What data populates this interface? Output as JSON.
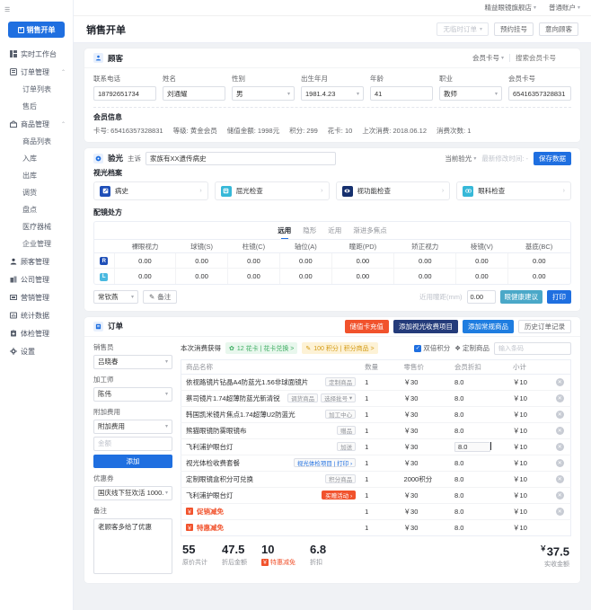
{
  "topbar": {
    "store": "精益眼镜旗舰店",
    "account": "普通账户"
  },
  "sidebar": {
    "collapse_icon": "☰",
    "primary_button": "销售开单",
    "items": [
      {
        "label": "实时工作台",
        "icon": "dashboard-icon",
        "type": "item"
      },
      {
        "label": "订单管理",
        "icon": "order-icon",
        "type": "group"
      },
      {
        "label": "订单列表",
        "type": "sub"
      },
      {
        "label": "售后",
        "type": "sub"
      },
      {
        "label": "商品管理",
        "icon": "goods-icon",
        "type": "group"
      },
      {
        "label": "商品列表",
        "type": "sub"
      },
      {
        "label": "入库",
        "type": "sub"
      },
      {
        "label": "出库",
        "type": "sub"
      },
      {
        "label": "调货",
        "type": "sub"
      },
      {
        "label": "盘点",
        "type": "sub"
      },
      {
        "label": "医疗器械",
        "type": "sub"
      },
      {
        "label": "企业管理",
        "type": "sub"
      },
      {
        "label": "顾客管理",
        "icon": "user-icon",
        "type": "item"
      },
      {
        "label": "公司管理",
        "icon": "company-icon",
        "type": "item"
      },
      {
        "label": "营销管理",
        "icon": "marketing-icon",
        "type": "item"
      },
      {
        "label": "统计数据",
        "icon": "chart-icon",
        "type": "item"
      },
      {
        "label": "体检管理",
        "icon": "clipboard-icon",
        "type": "item"
      },
      {
        "label": "设置",
        "icon": "gear-icon",
        "type": "item"
      }
    ]
  },
  "page": {
    "title": "销售开单",
    "actions": {
      "temp_order": "无临时订单",
      "appointment": "预约挂号",
      "intent_customer": "意向顾客"
    }
  },
  "customer": {
    "title": "顾客",
    "search_select": "会员卡号",
    "search_placeholder": "搜索会员卡号",
    "fields": [
      {
        "label": "联系电话",
        "value": "18792651734",
        "type": "input"
      },
      {
        "label": "姓名",
        "value": "刘通耀",
        "type": "input"
      },
      {
        "label": "性别",
        "value": "男",
        "type": "select"
      },
      {
        "label": "出生年月",
        "value": "1981.4.23",
        "type": "select"
      },
      {
        "label": "年龄",
        "value": "41",
        "type": "input"
      },
      {
        "label": "职业",
        "value": "教师",
        "type": "select"
      },
      {
        "label": "会员卡号",
        "value": "65416357328831",
        "type": "input"
      }
    ],
    "member_title": "会员信息",
    "member_info": [
      "卡号: 65416357328831",
      "等级: 黄金会员",
      "储值金额: 1998元",
      "积分: 299",
      "花卡: 10",
      "上次消费: 2018.06.12",
      "消费次数: 1"
    ]
  },
  "optometry": {
    "title": "验光",
    "complaint_label": "主诉",
    "complaint_value": "家族有XX遗传病史",
    "current_select": "当前验光",
    "modified_label": "最新修改时间: -",
    "save_button": "保存数据",
    "archive_title": "视光档案",
    "archive_cards": [
      {
        "label": "病史",
        "icon": "history-icon",
        "color": "#1f4fb8"
      },
      {
        "label": "屈光检查",
        "icon": "refraction-icon",
        "color": "#36b8d8"
      },
      {
        "label": "视功能检查",
        "icon": "vision-function-icon",
        "color": "#16306e"
      },
      {
        "label": "眼科检查",
        "icon": "eye-exam-icon",
        "color": "#36b8d8"
      }
    ],
    "rx_title": "配镜处方",
    "rx_tabs": [
      "远用",
      "隐形",
      "近用",
      "渐进多焦点"
    ],
    "rx_active_tab": "远用",
    "rx_columns": [
      "裸眼视力",
      "球镜(S)",
      "柱镜(C)",
      "轴位(A)",
      "瞳距(PD)",
      "矫正视力",
      "棱镜(V)",
      "基底(BC)"
    ],
    "rx_rows": [
      {
        "eye": "R",
        "color": "#1f4fb8",
        "values": [
          "0.00",
          "0.00",
          "0.00",
          "0.00",
          "0.00",
          "0.00",
          "0.00",
          "0.00"
        ]
      },
      {
        "eye": "L",
        "color": "#4ab9e0",
        "values": [
          "0.00",
          "0.00",
          "0.00",
          "0.00",
          "0.00",
          "0.00",
          "0.00",
          "0.00"
        ]
      }
    ],
    "optometrist": "常钦燕",
    "remark_button": "备注",
    "near_pd_label": "近用瞳距(mm)",
    "near_pd_value": "0.00",
    "health_advice_button": "眼健康建议",
    "print_button": "打印"
  },
  "order": {
    "title": "订单",
    "actions": {
      "recharge": "储值卡充值",
      "add_optometry_fee": "添加视光收费项目",
      "add_goods": "添加常规商品",
      "history": "历史订单记录"
    },
    "left": {
      "salesperson_label": "销售员",
      "salesperson_value": "吕晓春",
      "technician_label": "加工师",
      "technician_value": "陈伟",
      "extra_fee_label": "附加费用",
      "extra_fee_value": "附加费用",
      "amount_placeholder": "金额",
      "add_button": "添加",
      "coupon_label": "优惠券",
      "coupon_value": "国庆线下狂欢活 1000...",
      "remark_label": "备注",
      "remark_value": "老顾客多给了优惠"
    },
    "promo": {
      "prefix": "本次消费获得",
      "flower_card": "12 花卡 | 花卡兑换 >",
      "points": "100 积分 | 积分商品 >",
      "double_points": "双倍积分",
      "custom_goods": "定制商品",
      "barcode_placeholder": "输入条码"
    },
    "table_columns": [
      "商品名称",
      "数量",
      "零售价",
      "会员折扣",
      "小计"
    ],
    "rows": [
      {
        "name": "依视路镜片钻晶A4防蓝光1.56非球面镜片",
        "tags": [
          {
            "text": "定制商品",
            "style": "plain"
          }
        ],
        "qty": "1",
        "price": "￥30",
        "discount": "8.0",
        "subtotal": "￥10",
        "deletable": true
      },
      {
        "name": "蔡司镜片1.74超薄防蓝光新清锐",
        "tags": [
          {
            "text": "调货商品",
            "style": "plain"
          },
          {
            "text": "选择批号",
            "style": "select"
          }
        ],
        "qty": "1",
        "price": "￥30",
        "discount": "8.0",
        "subtotal": "￥10",
        "deletable": true
      },
      {
        "name": "韩国凯米镜片焦点1.74超薄U2防蓝光",
        "tags": [
          {
            "text": "加工中心",
            "style": "plain"
          }
        ],
        "qty": "1",
        "price": "￥30",
        "discount": "8.0",
        "subtotal": "￥10",
        "deletable": true
      },
      {
        "name": "熊猫眼镜防雾眼镜布",
        "tags": [
          {
            "text": "赠品",
            "style": "plain"
          }
        ],
        "qty": "1",
        "price": "￥30",
        "discount": "8.0",
        "subtotal": "￥10",
        "deletable": true
      },
      {
        "name": "飞利浦护眼台灯",
        "tags": [
          {
            "text": "加送",
            "style": "plain"
          }
        ],
        "qty": "1",
        "price": "￥30",
        "discount": "8.0",
        "subtotal": "￥10",
        "deletable": true,
        "discount_editing": true
      },
      {
        "name": "视光体检收费套餐",
        "tags": [
          {
            "text": "视光体检项目 | 打印 ›",
            "style": "link"
          }
        ],
        "qty": "1",
        "price": "￥30",
        "discount": "8.0",
        "subtotal": "￥10",
        "deletable": true
      },
      {
        "name": "定制眼镜盒积分可兑换",
        "tags": [
          {
            "text": "积分商品",
            "style": "plain"
          }
        ],
        "qty": "1",
        "price": "2000积分",
        "discount": "8.0",
        "subtotal": "￥10",
        "deletable": true
      },
      {
        "name": "飞利浦护眼台灯",
        "tags": [
          {
            "text": "买赠活动 ›",
            "style": "orange"
          }
        ],
        "qty": "1",
        "price": "￥30",
        "discount": "8.0",
        "subtotal": "￥10",
        "deletable": true
      },
      {
        "name": "促销减免",
        "badge": true,
        "tags": [],
        "qty": "1",
        "price": "￥30",
        "discount": "8.0",
        "subtotal": "￥10",
        "deletable": true
      },
      {
        "name": "特惠减免",
        "badge": true,
        "tags": [],
        "qty": "1",
        "price": "￥30",
        "discount": "8.0",
        "subtotal": "￥10",
        "deletable": false
      }
    ],
    "totals": [
      {
        "value": "55",
        "label": "原价共计",
        "badge": false
      },
      {
        "value": "47.5",
        "label": "折后金额",
        "badge": false
      },
      {
        "value": "10",
        "label": "特惠减免",
        "badge": true
      },
      {
        "value": "6.8",
        "label": "折扣",
        "badge": false
      }
    ],
    "final": {
      "value": "37.5",
      "currency": "￥",
      "label": "实收金额"
    }
  },
  "colors": {
    "primary": "#1f6fe0",
    "orange": "#f1522c",
    "navy": "#243b7a",
    "teal": "#4aa8c8"
  }
}
